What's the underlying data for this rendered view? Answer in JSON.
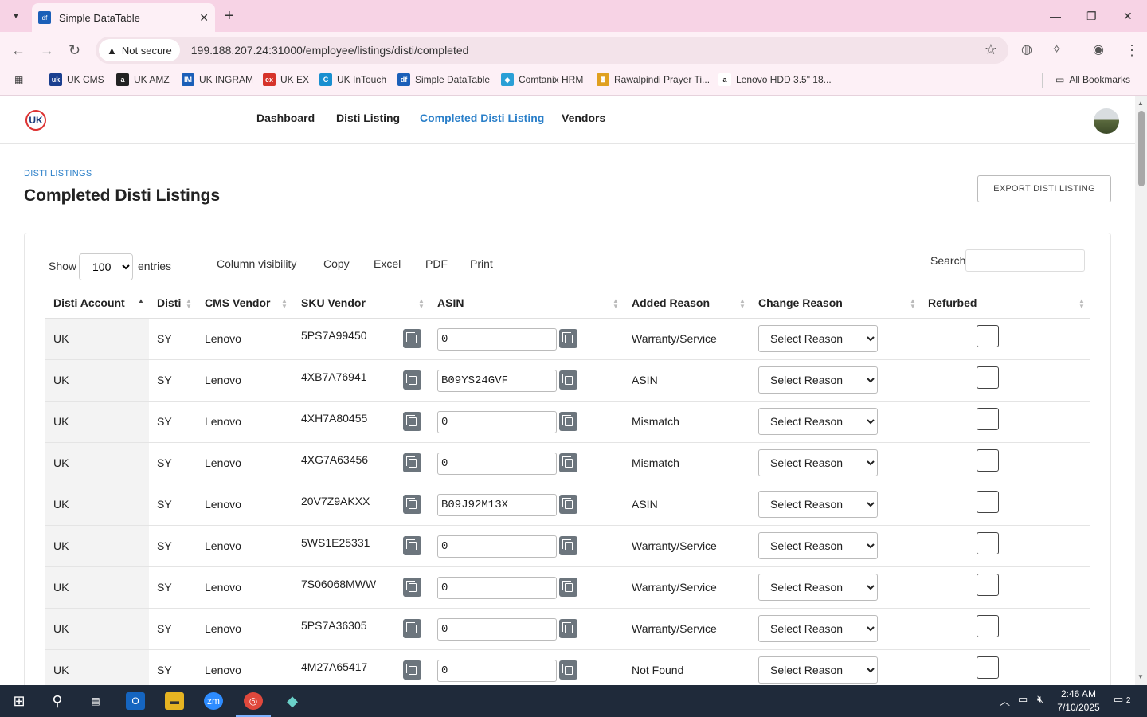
{
  "browser": {
    "tab_title": "Simple DataTable",
    "tab_favicon": "df",
    "not_secure": "Not secure",
    "url": "199.188.207.24:31000/employee/listings/disti/completed",
    "bookmarks": [
      {
        "label": "UK CMS",
        "icon": "uk-cms-icon",
        "color": "#1b3f8f",
        "glyph": "uk"
      },
      {
        "label": "UK AMZ",
        "icon": "amazon-icon",
        "color": "#222222",
        "glyph": "a"
      },
      {
        "label": "UK INGRAM",
        "icon": "ingram-icon",
        "color": "#1b5fb8",
        "glyph": "IM"
      },
      {
        "label": "UK EX",
        "icon": "ex-icon",
        "color": "#d6332a",
        "glyph": "ex"
      },
      {
        "label": "UK InTouch",
        "icon": "intouch-icon",
        "color": "#1a8fd0",
        "glyph": "C"
      },
      {
        "label": "Simple DataTable",
        "icon": "datatable-icon",
        "color": "#1b5fb8",
        "glyph": "df"
      },
      {
        "label": "Comtanix HRM",
        "icon": "comtanix-icon",
        "color": "#2a9fd6",
        "glyph": "◆"
      },
      {
        "label": "Rawalpindi Prayer Ti...",
        "icon": "mosque-icon",
        "color": "#e0a020",
        "glyph": "♜"
      },
      {
        "label": "Lenovo HDD 3.5\" 18...",
        "icon": "amazon-icon",
        "color": "#ffffff",
        "glyph": "a"
      }
    ],
    "all_bookmarks": "All Bookmarks"
  },
  "app": {
    "logo": "UK",
    "nav": [
      "Dashboard",
      "Disti Listing",
      "Completed Disti Listing",
      "Vendors"
    ],
    "active_nav": "Completed Disti Listing"
  },
  "page": {
    "breadcrumb": "DISTI LISTINGS",
    "title": "Completed Disti Listings",
    "export_label": "EXPORT DISTI LISTING"
  },
  "controls": {
    "show": "Show",
    "entries_value": "100",
    "entries": "entries",
    "buttons": [
      "Column visibility",
      "Copy",
      "Excel",
      "PDF",
      "Print"
    ],
    "search_label": "Search"
  },
  "table": {
    "columns": [
      "Disti Account",
      "Disti",
      "CMS Vendor",
      "SKU Vendor",
      "ASIN",
      "Added Reason",
      "Change Reason",
      "Refurbed"
    ],
    "select_placeholder": "Select Reason",
    "rows": [
      {
        "account": "UK",
        "disti": "SY",
        "vendor": "Lenovo",
        "sku": "5PS7A99450",
        "asin": "0",
        "added_reason": "Warranty/Service"
      },
      {
        "account": "UK",
        "disti": "SY",
        "vendor": "Lenovo",
        "sku": "4XB7A76941",
        "asin": "B09YS24GVF",
        "added_reason": "ASIN"
      },
      {
        "account": "UK",
        "disti": "SY",
        "vendor": "Lenovo",
        "sku": "4XH7A80455",
        "asin": "0",
        "added_reason": "Mismatch"
      },
      {
        "account": "UK",
        "disti": "SY",
        "vendor": "Lenovo",
        "sku": "4XG7A63456",
        "asin": "0",
        "added_reason": "Mismatch"
      },
      {
        "account": "UK",
        "disti": "SY",
        "vendor": "Lenovo",
        "sku": "20V7Z9AKXX",
        "asin": "B09J92M13X",
        "added_reason": "ASIN"
      },
      {
        "account": "UK",
        "disti": "SY",
        "vendor": "Lenovo",
        "sku": "5WS1E25331",
        "asin": "0",
        "added_reason": "Warranty/Service"
      },
      {
        "account": "UK",
        "disti": "SY",
        "vendor": "Lenovo",
        "sku": "7S06068MWW",
        "asin": "0",
        "added_reason": "Warranty/Service"
      },
      {
        "account": "UK",
        "disti": "SY",
        "vendor": "Lenovo",
        "sku": "5PS7A36305",
        "asin": "0",
        "added_reason": "Warranty/Service"
      },
      {
        "account": "UK",
        "disti": "SY",
        "vendor": "Lenovo",
        "sku": "4M27A65417",
        "asin": "0",
        "added_reason": "Not Found"
      }
    ]
  },
  "taskbar": {
    "time": "2:46 AM",
    "date": "7/10/2025",
    "notifications": "2"
  },
  "colors": {
    "accent": "#2a7fc9",
    "tabbar": "#f7d3e5",
    "taskbar": "#1f2a3a"
  }
}
